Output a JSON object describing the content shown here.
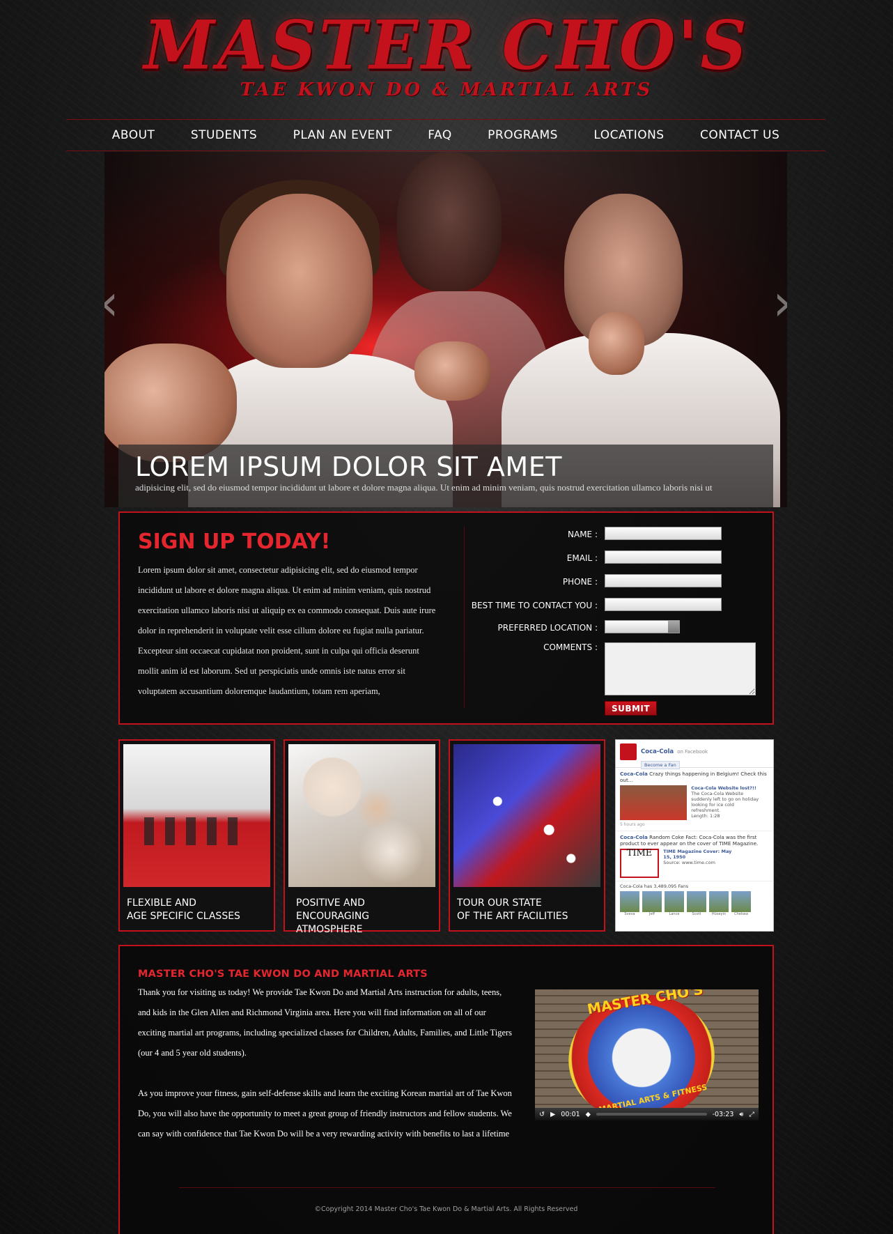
{
  "brand": {
    "title": "MASTER CHO'S",
    "subtitle": "TAE KWON DO & MARTIAL ARTS",
    "accent_color": "#c4121d"
  },
  "nav": {
    "items": [
      "ABOUT",
      "STUDENTS",
      "PLAN AN EVENT",
      "FAQ",
      "PROGRAMS",
      "LOCATIONS",
      "CONTACT US"
    ]
  },
  "hero": {
    "title": "LOREM IPSUM DOLOR SIT AMET",
    "text": "adipisicing elit, sed do eiusmod tempor incididunt ut labore et dolore magna aliqua. Ut enim ad minim veniam, quis nostrud exercitation ullamco laboris nisi ut",
    "prev_icon": "chevron-left-icon",
    "next_icon": "chevron-right-icon"
  },
  "signup": {
    "title": "SIGN UP TODAY!",
    "text": "Lorem ipsum dolor sit amet, consectetur adipisicing elit, sed do eiusmod tempor incididunt ut labore et dolore magna aliqua. Ut enim ad minim veniam, quis nostrud exercitation ullamco laboris nisi ut aliquip ex ea commodo consequat. Duis aute irure dolor in reprehenderit in voluptate velit esse cillum dolore eu fugiat nulla pariatur. Excepteur sint occaecat cupidatat non proident, sunt in culpa qui officia deserunt mollit anim id est laborum. Sed ut perspiciatis unde omnis iste natus error sit voluptatem accusantium doloremque laudantium, totam rem aperiam,",
    "labels": {
      "name": "NAME :",
      "email": "EMAIL :",
      "phone": "PHONE :",
      "best_time": "BEST TIME TO CONTACT YOU :",
      "location": "PREFERRED LOCATION :",
      "comments": "COMMENTS :"
    },
    "submit": "SUBMIT"
  },
  "cards": [
    {
      "line1": "FLEXIBLE AND",
      "line2": "AGE SPECIFIC CLASSES"
    },
    {
      "line1": "POSITIVE AND",
      "line2": "ENCOURAGING ATMOSPHERE"
    },
    {
      "line1": "TOUR OUR STATE",
      "line2": "OF THE ART FACILITIES"
    }
  ],
  "facebook": {
    "page_name": "Coca-Cola",
    "on_facebook": "on Facebook",
    "become_fan": "Become a Fan",
    "post1_author": "Coca-Cola",
    "post1_text": "Crazy things happening in Belgium! Check this out...",
    "post1_link": "Coca-Cola Website lost?!!",
    "post1_desc": "The Coca-Cola Website suddenly left to go on holiday looking for ice cold refreshment.",
    "post1_length": "Length: 1:28",
    "post1_time": "5 hours ago",
    "post2_author": "Coca-Cola",
    "post2_text": "Random Coke Fact: Coca-Cola was the first product to ever appear on the cover of TIME Magazine.",
    "post2_link": "TIME Magazine Cover: May 15, 1950",
    "post2_source": "Source: www.time.com",
    "time_logo": "TIME",
    "fans": "Coca-Cola has 3,489,095 Fans",
    "fan_names": [
      "Sveva",
      "Jeff",
      "Lance",
      "Scott",
      "Hüseyin",
      "Chelsea"
    ]
  },
  "about": {
    "title": "MASTER CHO'S TAE KWON DO AND MARTIAL ARTS",
    "para1": "Thank you for visiting us today! We provide Tae Kwon Do and Martial Arts instruction for adults, teens, and kids in the Glen Allen and Richmond Virginia area. Here you will find information on all of our exciting martial art programs, including specialized classes for Children, Adults, Families, and Little Tigers (our 4 and 5 year old students).",
    "para2": "As you improve your fitness, gain self-defense skills and learn the exciting Korean martial art of Tae Kwon Do, you will also have the opportunity to meet a great group of friendly instructors and fellow students. We can say with confidence that Tae Kwon Do will be a very rewarding activity with benefits to last a lifetime"
  },
  "video": {
    "logo_text": "MASTER CHO'S",
    "logo_sub": "MARTIAL ARTS & FITNESS",
    "current_time": "00:01",
    "remaining_time": "-03:23"
  },
  "footer": {
    "copyright": "©Copyright 2014 Master Cho's Tae Kwon Do & Martial Arts. All Rights Reserved"
  }
}
